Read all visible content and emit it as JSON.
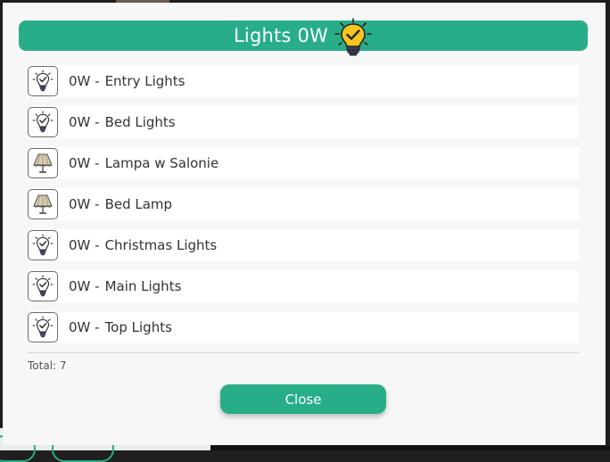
{
  "dialog": {
    "title": "Lights 0W",
    "title_icon": "lightbulb-check-icon",
    "total": "Total: 7",
    "close_label": "Close"
  },
  "items": [
    {
      "power": "0W -",
      "name": "Entry Lights",
      "icon": "bulb-icon"
    },
    {
      "power": "0W -",
      "name": "Bed Lights",
      "icon": "bulb-icon"
    },
    {
      "power": "0W -",
      "name": "Lampa w Salonie",
      "icon": "lamp-icon"
    },
    {
      "power": "0W -",
      "name": "Bed Lamp",
      "icon": "lamp-icon"
    },
    {
      "power": "0W -",
      "name": "Christmas Lights",
      "icon": "bulb-icon"
    },
    {
      "power": "0W -",
      "name": "Main Lights",
      "icon": "bulb-icon"
    },
    {
      "power": "0W -",
      "name": "Top Lights",
      "icon": "bulb-icon"
    }
  ],
  "colors": {
    "accent": "#27ae89",
    "bulb_yellow": "#f7c51e"
  }
}
